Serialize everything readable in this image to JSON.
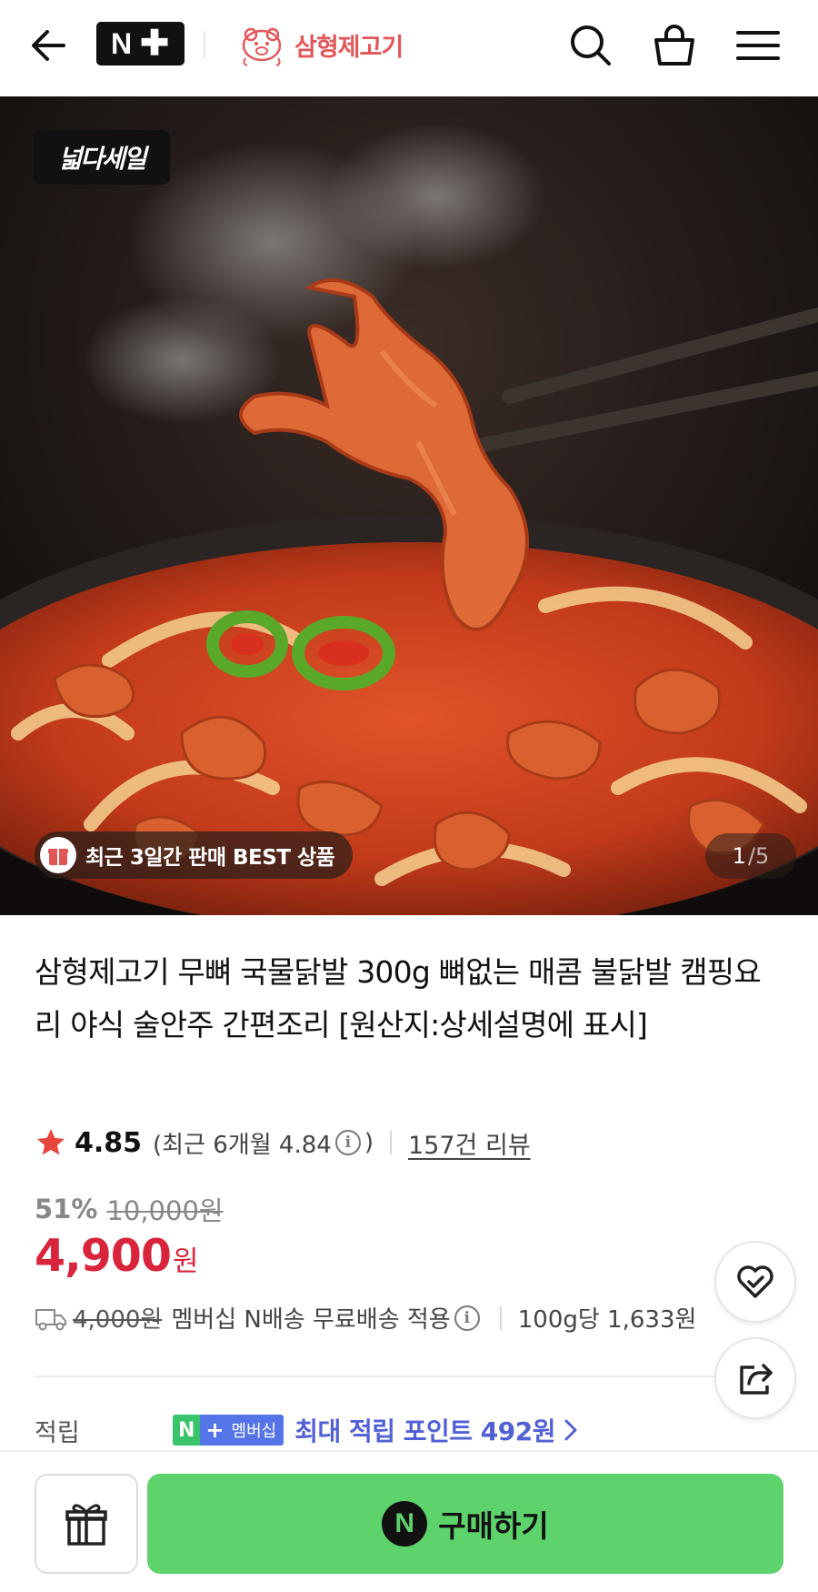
{
  "header": {
    "nplus_logo_letter": "N",
    "brand_name": "삼형제고기"
  },
  "hero": {
    "sale_badge": "넓다세일",
    "best_chip": "최근 3일간 판매 BEST 상품",
    "pager_current": "1",
    "pager_total": "/5"
  },
  "product": {
    "title": "삼형제고기 무뼈 국물닭발 300g 뼈없는 매콤 불닭발 캠핑요리 야식 술안주 간편조리 [원산지:상세설명에 표시]",
    "rating": "4.85",
    "rating_recent_prefix": "(최근 6개월 4.84",
    "rating_recent_suffix": ")",
    "info_glyph": "i",
    "reviews": "157건 리뷰",
    "discount_percent": "51%",
    "original_price": "10,000원",
    "price": "4,900",
    "currency": "원",
    "shipping_original": "4,000원",
    "shipping_text": "멤버십 N배송 무료배송 적용",
    "unit_price": "100g당 1,633원",
    "points_label": "적립",
    "member_badge_n": "N",
    "member_badge_plus": "+",
    "member_badge_text": "멤버십",
    "points_text": "최대 적립 포인트 492원"
  },
  "bottom": {
    "buy_label": "구매하기",
    "buy_icon_letter": "N"
  },
  "colors": {
    "price_red": "#d8253b",
    "buy_green": "#5ed36c",
    "points_purple": "#5260d6",
    "brand_red": "#e2575a"
  }
}
